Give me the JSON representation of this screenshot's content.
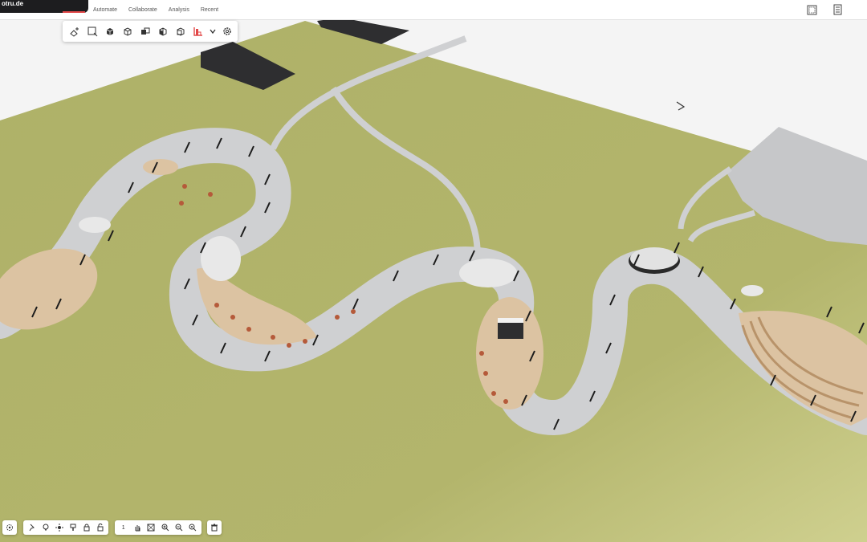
{
  "browser": {
    "url_fragment": "otru.de"
  },
  "menu": {
    "items": [
      "Automate",
      "Collaborate",
      "Analysis",
      "Recent"
    ]
  },
  "toolbar": {
    "icons": [
      "add-object-icon",
      "select-box-icon",
      "cube-icon",
      "cube-outline-icon",
      "cubes-icon",
      "cube-split-icon",
      "cube-front-icon",
      "chart-icon",
      "chevron-down-icon",
      "settings-icon"
    ],
    "accent": "#e24848"
  },
  "top_right": {
    "icons": [
      "frame-icon",
      "panel-icon"
    ]
  },
  "bottom_toolbar": {
    "settings_icon": "gear-icon",
    "group2": [
      "pin-icon",
      "light-icon",
      "sun-icon",
      "paint-icon",
      "lock-icon",
      "unlock-icon"
    ],
    "group3_label": "1",
    "group3": [
      "hand-icon",
      "fit-icon",
      "zoom-in-icon",
      "zoom-out-icon",
      "zoom-icon"
    ],
    "trash_icon": "trash-icon"
  },
  "colors": {
    "grass": "#b3b56c",
    "path": "#cfd0d2",
    "deck": "#dcc3a2",
    "building": "#3a3a3c"
  }
}
